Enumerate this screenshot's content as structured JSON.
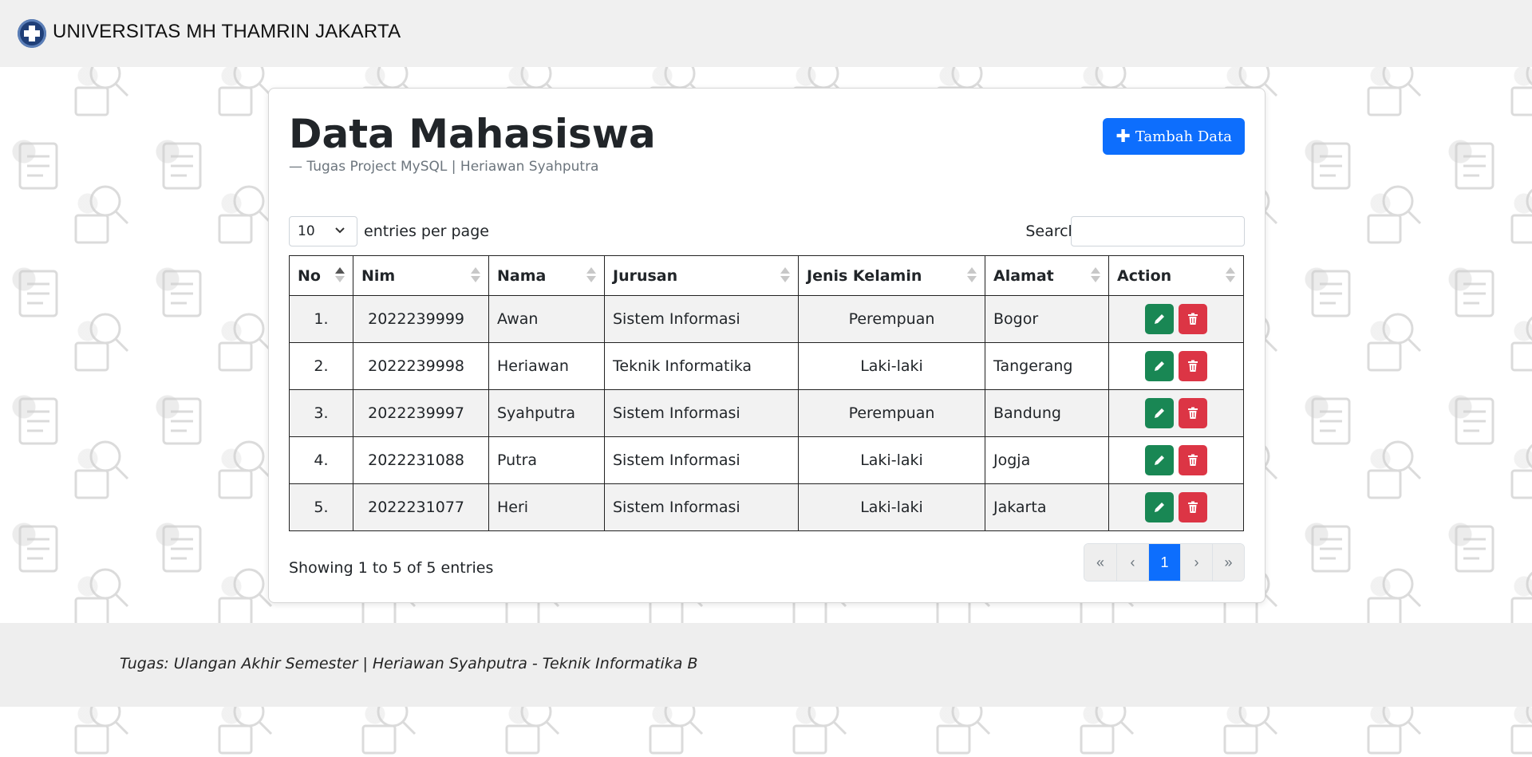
{
  "navbar": {
    "brand": "UNIVERSITAS MH THAMRIN JAKARTA",
    "logo_icon": "university-cross-logo"
  },
  "header": {
    "title": "Data Mahasiswa",
    "subtitle": "— Tugas Project MySQL | Heriawan Syahputra",
    "add_button": "Tambah Data",
    "add_icon": "plus-icon"
  },
  "controls": {
    "entries_value": "10",
    "entries_label": "entries per page",
    "search_label": "Search:",
    "search_value": ""
  },
  "table": {
    "columns": [
      "No",
      "Nim",
      "Nama",
      "Jurusan",
      "Jenis Kelamin",
      "Alamat",
      "Action"
    ],
    "sorted_column": "No",
    "rows": [
      {
        "no": "1.",
        "nim": "2022239999",
        "nama": "Awan",
        "jurusan": "Sistem Informasi",
        "jk": "Perempuan",
        "alamat": "Bogor"
      },
      {
        "no": "2.",
        "nim": "2022239998",
        "nama": "Heriawan",
        "jurusan": "Teknik Informatika",
        "jk": "Laki-laki",
        "alamat": "Tangerang"
      },
      {
        "no": "3.",
        "nim": "2022239997",
        "nama": "Syahputra",
        "jurusan": "Sistem Informasi",
        "jk": "Perempuan",
        "alamat": "Bandung"
      },
      {
        "no": "4.",
        "nim": "2022231088",
        "nama": "Putra",
        "jurusan": "Sistem Informasi",
        "jk": "Laki-laki",
        "alamat": "Jogja"
      },
      {
        "no": "5.",
        "nim": "2022231077",
        "nama": "Heri",
        "jurusan": "Sistem Informasi",
        "jk": "Laki-laki",
        "alamat": "Jakarta"
      }
    ],
    "action_icons": [
      "pencil-icon",
      "trash-icon"
    ]
  },
  "footer_info": "Showing 1 to 5 of 5 entries",
  "pagination": {
    "first": "«",
    "prev": "‹",
    "current": "1",
    "next": "›",
    "last": "»"
  },
  "footer": {
    "text": "Tugas: Ulangan Akhir Semester | Heriawan Syahputra - Teknik Informatika B"
  },
  "colors": {
    "primary": "#0d6efd",
    "edit": "#198754",
    "delete": "#dc3545",
    "navbar_bg": "#f0f0f0"
  }
}
